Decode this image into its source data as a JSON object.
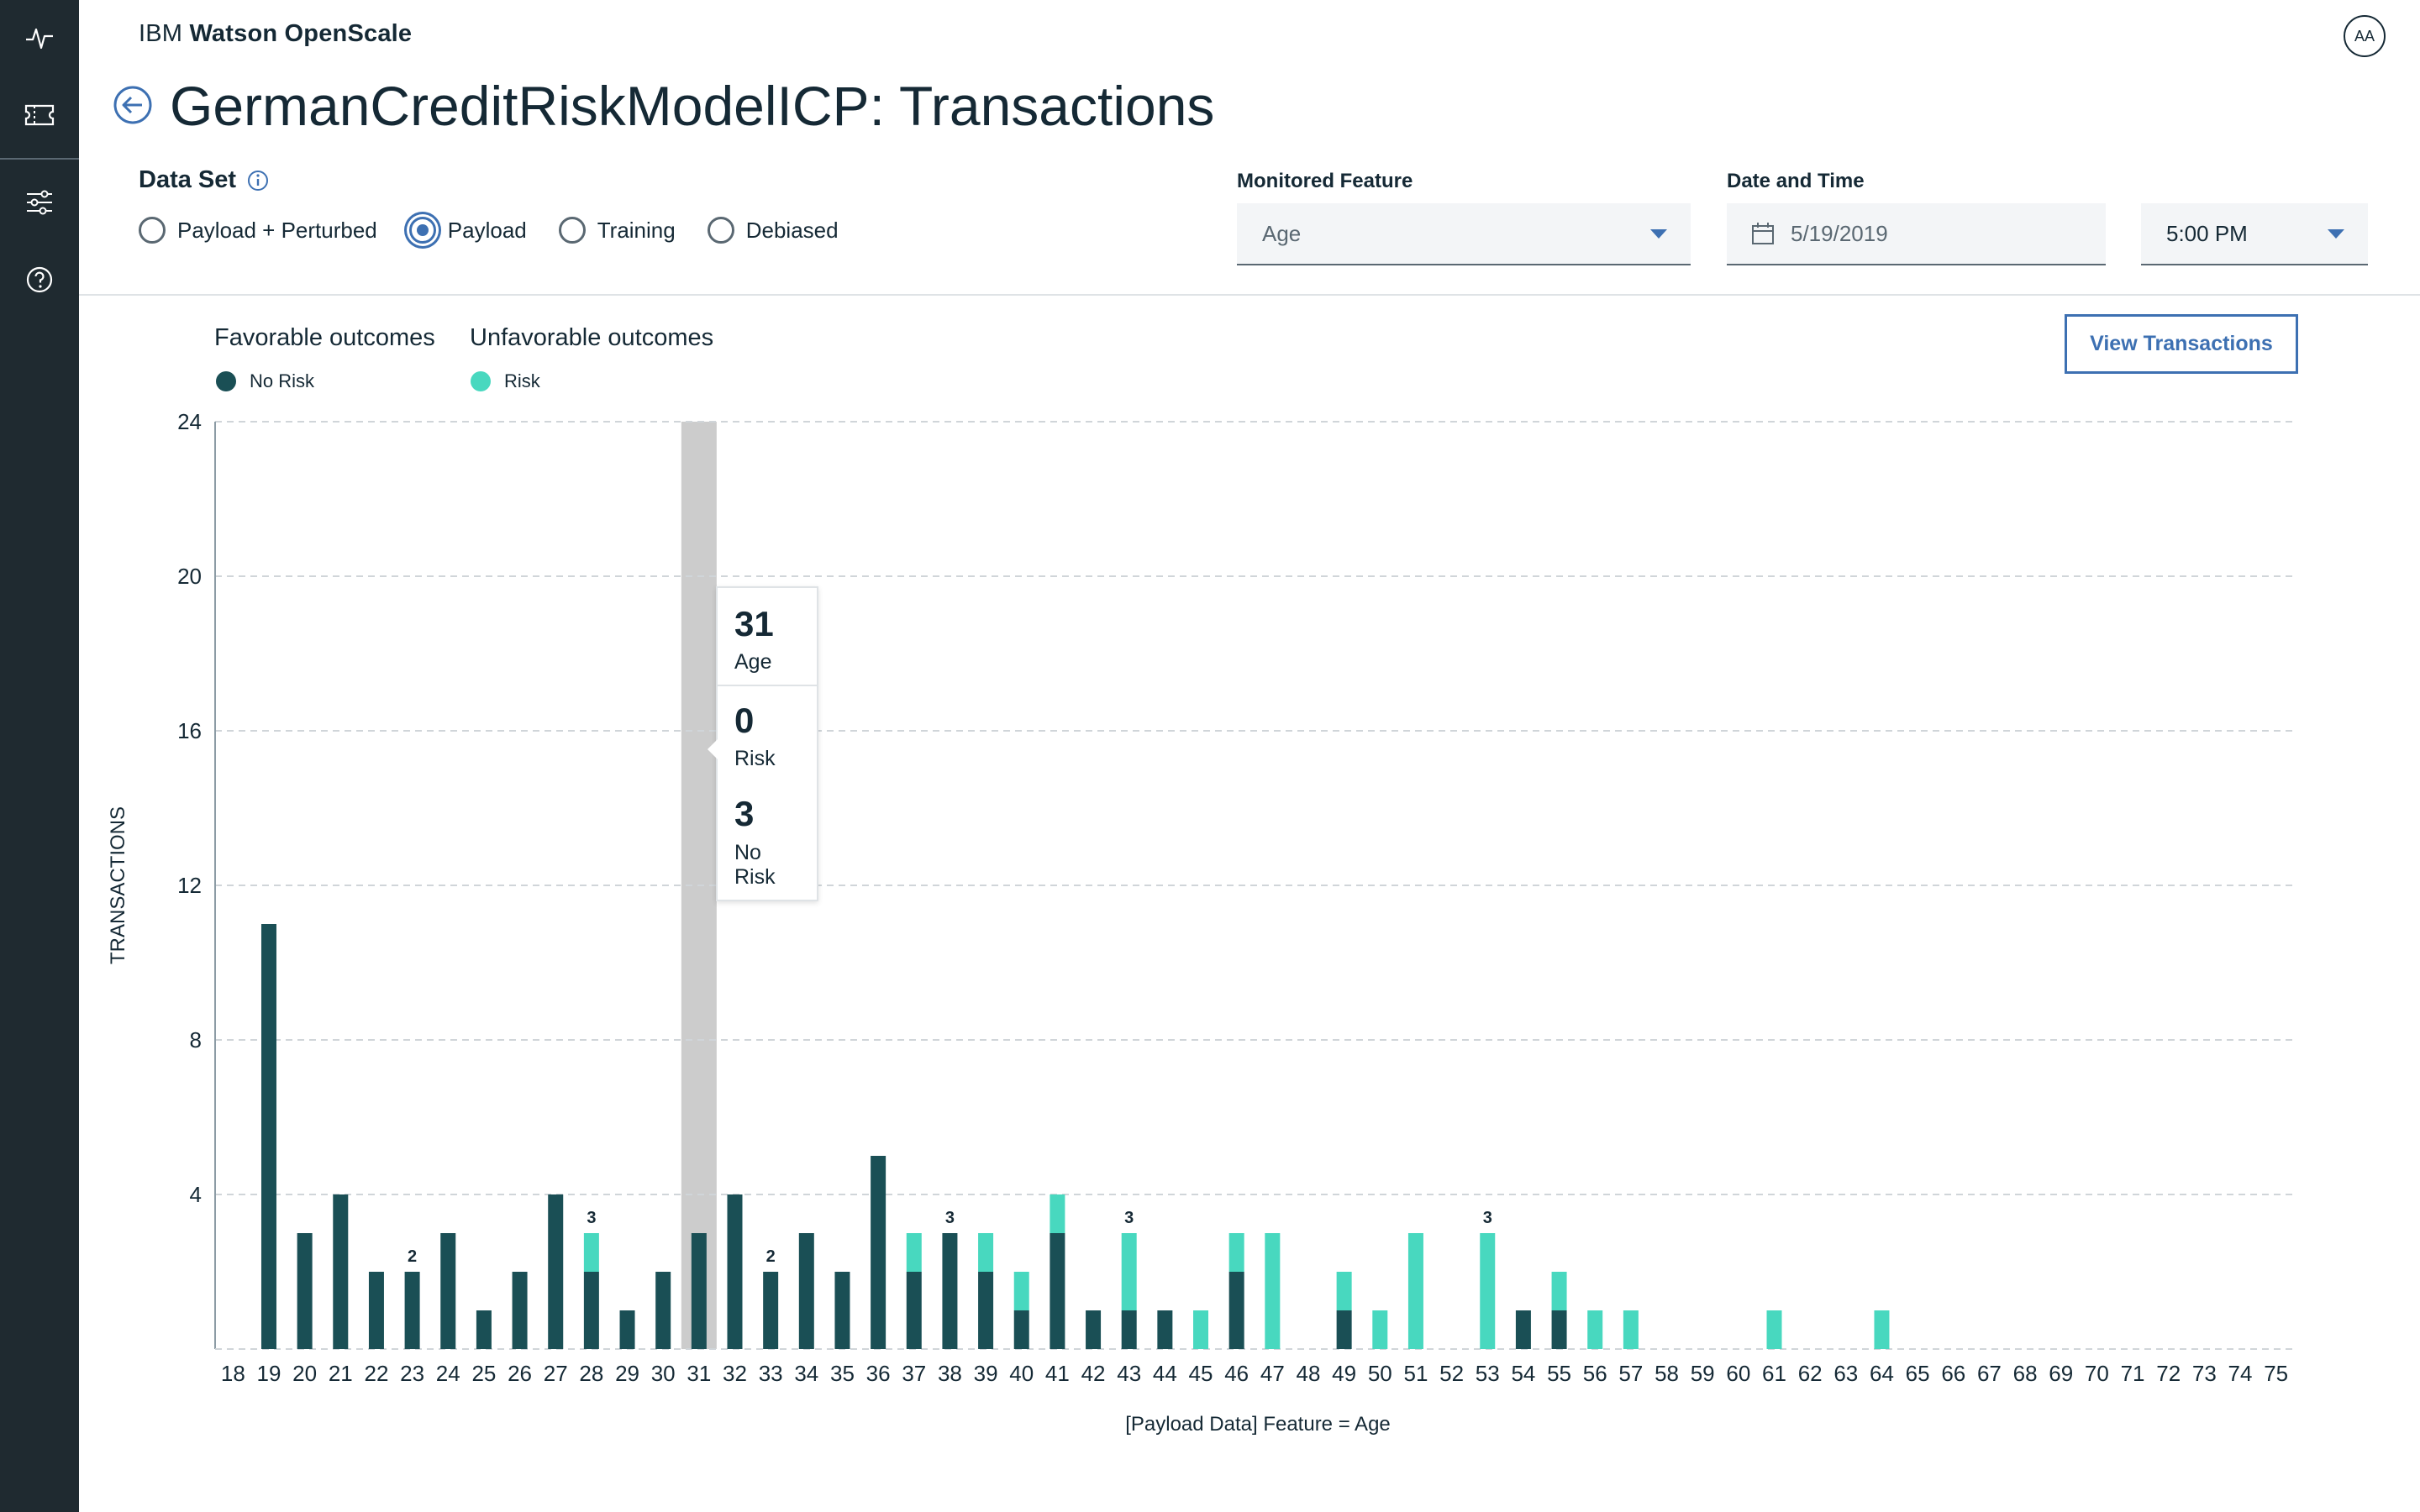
{
  "app": {
    "brand_prefix": "IBM",
    "brand_name": "Watson OpenScale",
    "avatar_initials": "AA"
  },
  "rail": {
    "icons": [
      "activity-icon",
      "ticket-icon",
      "sliders-icon",
      "help-icon"
    ]
  },
  "page_title": "GermanCreditRiskModelICP: Transactions",
  "data_set": {
    "label": "Data Set",
    "options": [
      "Payload + Perturbed",
      "Payload",
      "Training",
      "Debiased"
    ],
    "selected": "Payload"
  },
  "filters": {
    "monitored_feature_label": "Monitored Feature",
    "monitored_feature_value": "Age",
    "date_time_label": "Date and Time",
    "date_value": "5/19/2019",
    "time_value": "5:00 PM"
  },
  "legend": {
    "favorable_heading": "Favorable outcomes",
    "unfavorable_heading": "Unfavorable outcomes",
    "favorable_item": "No Risk",
    "unfavorable_item": "Risk"
  },
  "view_transactions_label": "View Transactions",
  "colors": {
    "no_risk": "#1a4f55",
    "risk": "#48d8bf",
    "accent": "#3d70b2",
    "highlight": "#cccccc"
  },
  "tooltip": {
    "age_value": "31",
    "age_label": "Age",
    "risk_value": "0",
    "risk_label": "Risk",
    "no_risk_value": "3",
    "no_risk_label": "No Risk"
  },
  "chart_data": {
    "type": "bar",
    "stacked": true,
    "xlabel": "[Payload Data] Feature = Age",
    "ylabel": "TRANSACTIONS",
    "ylim": [
      0,
      24
    ],
    "yticks": [
      4,
      8,
      12,
      16,
      20,
      24
    ],
    "grid": true,
    "highlighted_category": "31",
    "categories": [
      "18",
      "19",
      "20",
      "21",
      "22",
      "23",
      "24",
      "25",
      "26",
      "27",
      "28",
      "29",
      "30",
      "31",
      "32",
      "33",
      "34",
      "35",
      "36",
      "37",
      "38",
      "39",
      "40",
      "41",
      "42",
      "43",
      "44",
      "45",
      "46",
      "47",
      "48",
      "49",
      "50",
      "51",
      "52",
      "53",
      "54",
      "55",
      "56",
      "57",
      "58",
      "59",
      "60",
      "61",
      "62",
      "63",
      "64",
      "65",
      "66",
      "67",
      "68",
      "69",
      "70",
      "71",
      "72",
      "73",
      "74",
      "75"
    ],
    "series": [
      {
        "name": "No Risk",
        "values": [
          0,
          11,
          3,
          4,
          2,
          2,
          3,
          1,
          2,
          4,
          2,
          1,
          2,
          3,
          4,
          2,
          3,
          2,
          5,
          2,
          3,
          2,
          1,
          3,
          1,
          1,
          1,
          0,
          2,
          0,
          0,
          1,
          0,
          0,
          0,
          0,
          1,
          1,
          0,
          0,
          0,
          0,
          0,
          0,
          0,
          0,
          0,
          0,
          0,
          0,
          0,
          0,
          0,
          0,
          0,
          0,
          0,
          0
        ]
      },
      {
        "name": "Risk",
        "values": [
          0,
          0,
          0,
          0,
          0,
          0,
          0,
          0,
          0,
          0,
          1,
          0,
          0,
          0,
          0,
          0,
          0,
          0,
          0,
          1,
          0,
          1,
          1,
          1,
          0,
          2,
          0,
          1,
          1,
          3,
          0,
          1,
          1,
          3,
          0,
          3,
          0,
          1,
          1,
          1,
          0,
          0,
          0,
          1,
          0,
          0,
          1,
          0,
          0,
          0,
          0,
          0,
          0,
          0,
          0,
          0,
          0,
          0
        ]
      }
    ],
    "data_labels": [
      {
        "category": "23",
        "text": "2"
      },
      {
        "category": "28",
        "text": "3"
      },
      {
        "category": "33",
        "text": "2"
      },
      {
        "category": "38",
        "text": "3"
      },
      {
        "category": "43",
        "text": "3"
      },
      {
        "category": "53",
        "text": "3"
      }
    ]
  }
}
